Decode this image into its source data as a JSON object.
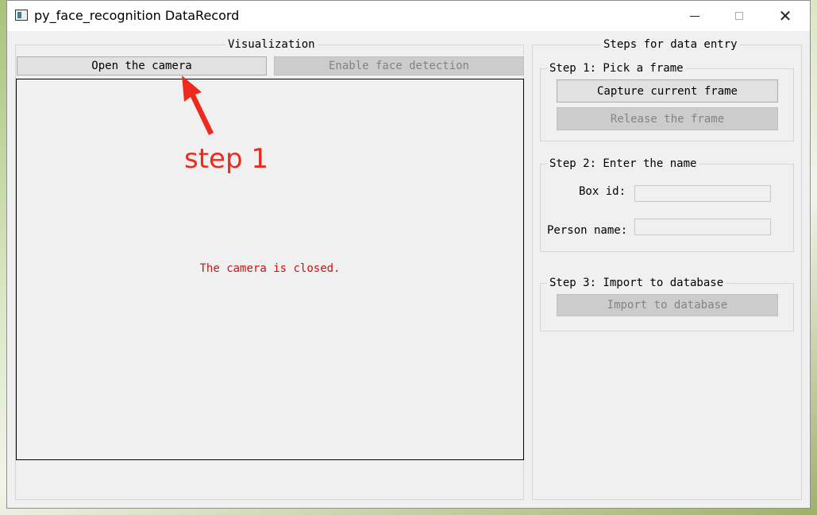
{
  "window": {
    "title": "py_face_recognition DataRecord",
    "controls": {
      "minimize": "—",
      "maximize": "□",
      "close": "✕"
    }
  },
  "visualization": {
    "group_title": "Visualization",
    "open_camera_label": "Open the camera",
    "face_detection_label": "Enable face detection",
    "camera_status": "The camera is closed."
  },
  "steps": {
    "group_title": "Steps for data entry",
    "step1": {
      "title": "Step 1: Pick a frame",
      "capture_label": "Capture current frame",
      "release_label": "Release the frame"
    },
    "step2": {
      "title": "Step 2: Enter the name",
      "box_id_label": "Box id:",
      "box_id_value": "",
      "person_name_label": "Person name:",
      "person_name_value": ""
    },
    "step3": {
      "title": "Step 3: Import to database",
      "import_label": "Import to database"
    }
  },
  "annotation": {
    "text": "step 1",
    "color": "#ee2a1f"
  }
}
